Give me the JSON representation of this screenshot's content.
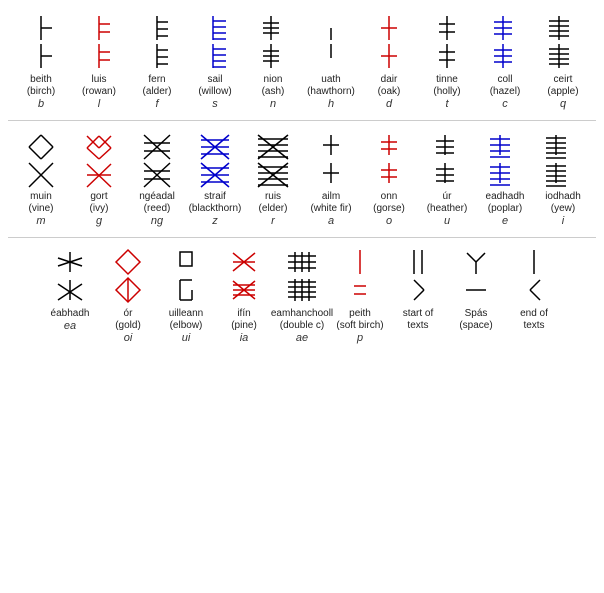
{
  "sections": [
    {
      "id": "section1",
      "chars": [
        {
          "name": "beith\n(birch)",
          "letter": "b",
          "glyph_id": "beith"
        },
        {
          "name": "luis\n(rowan)",
          "letter": "l",
          "glyph_id": "luis"
        },
        {
          "name": "fern\n(alder)",
          "letter": "f",
          "glyph_id": "fern"
        },
        {
          "name": "sail\n(willow)",
          "letter": "s",
          "glyph_id": "sail"
        },
        {
          "name": "nion\n(ash)",
          "letter": "n",
          "glyph_id": "nion"
        },
        {
          "name": "uath\n(hawthorn)",
          "letter": "h",
          "glyph_id": "uath"
        },
        {
          "name": "dair\n(oak)",
          "letter": "d",
          "glyph_id": "dair"
        },
        {
          "name": "tinne\n(holly)",
          "letter": "t",
          "glyph_id": "tinne"
        },
        {
          "name": "coll\n(hazel)",
          "letter": "c",
          "glyph_id": "coll"
        },
        {
          "name": "ceirt\n(apple)",
          "letter": "q",
          "glyph_id": "ceirt"
        }
      ]
    },
    {
      "id": "section2",
      "chars": [
        {
          "name": "muin\n(vine)",
          "letter": "m",
          "glyph_id": "muin"
        },
        {
          "name": "gort\n(ivy)",
          "letter": "g",
          "glyph_id": "gort"
        },
        {
          "name": "ngéadal\n(reed)",
          "letter": "ng",
          "glyph_id": "ngead"
        },
        {
          "name": "straif\n(blackthorn)",
          "letter": "z",
          "glyph_id": "straif"
        },
        {
          "name": "ruis\n(elder)",
          "letter": "r",
          "glyph_id": "ruis"
        },
        {
          "name": "ailm\n(white fir)",
          "letter": "a",
          "glyph_id": "ailm"
        },
        {
          "name": "onn\n(gorse)",
          "letter": "o",
          "glyph_id": "onn"
        },
        {
          "name": "úr\n(heather)",
          "letter": "u",
          "glyph_id": "ur"
        },
        {
          "name": "eadhadh\n(poplar)",
          "letter": "e",
          "glyph_id": "eadh"
        },
        {
          "name": "iodhadh\n(yew)",
          "letter": "i",
          "glyph_id": "iodh"
        }
      ]
    },
    {
      "id": "section3",
      "chars": [
        {
          "name": "éabhadh",
          "letter": "ea",
          "glyph_id": "eabh"
        },
        {
          "name": "ór\n(gold)",
          "letter": "oi",
          "glyph_id": "or"
        },
        {
          "name": "uilleann\n(elbow)",
          "letter": "ui",
          "glyph_id": "uill"
        },
        {
          "name": "ifín\n(pine)",
          "letter": "ia",
          "glyph_id": "ifin"
        },
        {
          "name": "eamhanchooll\n(double c)",
          "letter": "ae",
          "glyph_id": "eamh"
        },
        {
          "name": "peith\n(soft birch)",
          "letter": "p",
          "glyph_id": "peith"
        },
        {
          "name": "start of\ntexts",
          "letter": "",
          "glyph_id": "start"
        },
        {
          "name": "Spás\n(space)",
          "letter": "",
          "glyph_id": "spas"
        },
        {
          "name": "end of\ntexts",
          "letter": "",
          "glyph_id": "end"
        }
      ]
    }
  ]
}
